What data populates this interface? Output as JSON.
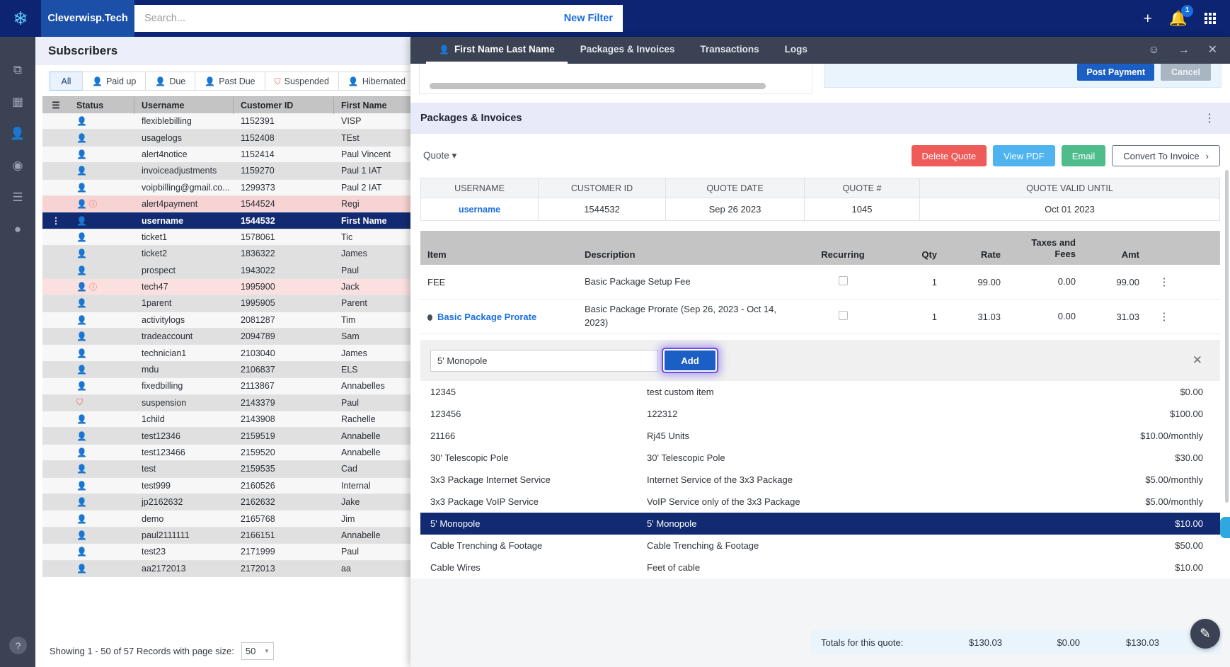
{
  "topbar": {
    "logo_icon": "footprint-logo-icon",
    "brand": "Cleverwisp.Tech",
    "search_placeholder": "Search...",
    "search_value": "",
    "new_filter": "New Filter",
    "plus_icon": "plus-icon",
    "bell_icon": "bell-icon",
    "notification_count": "1",
    "apps_icon": "apps-grid-icon"
  },
  "rail": {
    "items": [
      {
        "name": "copy-icon",
        "glyph": "⧉",
        "active": false
      },
      {
        "name": "dashboard-icon",
        "glyph": "▦",
        "active": false
      },
      {
        "name": "subscribers-icon",
        "glyph": "👤",
        "active": true
      },
      {
        "name": "globe-icon",
        "glyph": "◎",
        "active": false
      },
      {
        "name": "list-icon",
        "glyph": "☰",
        "active": false
      },
      {
        "name": "map-pin-icon",
        "glyph": "▾",
        "active": false
      }
    ],
    "help": "?"
  },
  "subscribers": {
    "title": "Subscribers",
    "tabs": [
      {
        "label": "All",
        "icon": "",
        "active": true
      },
      {
        "label": "Paid up",
        "icon": "person-green-icon",
        "active": false
      },
      {
        "label": "Due",
        "icon": "person-amber-icon",
        "active": false
      },
      {
        "label": "Past Due",
        "icon": "person-red-icon",
        "active": false
      },
      {
        "label": "Suspended",
        "icon": "person-outline-red-icon",
        "active": false
      },
      {
        "label": "Hibernated",
        "icon": "person-blue-icon",
        "active": false
      }
    ],
    "columns": [
      "",
      "Status",
      "Username",
      "Customer ID",
      "First Name"
    ],
    "rows": [
      {
        "status": "red",
        "warn": false,
        "username": "flexiblebilling",
        "customer_id": "1152391",
        "first_name": "VISP",
        "style": ""
      },
      {
        "status": "grey",
        "warn": false,
        "username": "usagelogs",
        "customer_id": "1152408",
        "first_name": "TEst",
        "style": "alt"
      },
      {
        "status": "red",
        "warn": false,
        "username": "alert4notice",
        "customer_id": "1152414",
        "first_name": "Paul Vincent",
        "style": ""
      },
      {
        "status": "green",
        "warn": false,
        "username": "invoiceadjustments",
        "customer_id": "1159270",
        "first_name": "Paul 1 IAT",
        "style": "alt"
      },
      {
        "status": "red",
        "warn": false,
        "username": "voipbilling@gmail.co...",
        "customer_id": "1299373",
        "first_name": "Paul 2 IAT",
        "style": ""
      },
      {
        "status": "red",
        "warn": true,
        "username": "alert4payment",
        "customer_id": "1544524",
        "first_name": "Regi",
        "style": "warn"
      },
      {
        "status": "amber",
        "warn": false,
        "username": "username",
        "customer_id": "1544532",
        "first_name": "First Name",
        "style": "sel"
      },
      {
        "status": "red",
        "warn": false,
        "username": "ticket1",
        "customer_id": "1578061",
        "first_name": "Tic",
        "style": ""
      },
      {
        "status": "red",
        "warn": false,
        "username": "ticket2",
        "customer_id": "1836322",
        "first_name": "James",
        "style": "alt"
      },
      {
        "status": "red",
        "warn": false,
        "username": "prospect",
        "customer_id": "1943022",
        "first_name": "Paul",
        "style": "alt"
      },
      {
        "status": "red",
        "warn": true,
        "username": "tech47",
        "customer_id": "1995900",
        "first_name": "Jack",
        "style": "warn-lt"
      },
      {
        "status": "red",
        "warn": false,
        "username": "1parent",
        "customer_id": "1995905",
        "first_name": "Parent",
        "style": "alt"
      },
      {
        "status": "red",
        "warn": false,
        "username": "activitylogs",
        "customer_id": "2081287",
        "first_name": "Tim",
        "style": ""
      },
      {
        "status": "red",
        "warn": false,
        "username": "tradeaccount",
        "customer_id": "2094789",
        "first_name": "Sam",
        "style": "alt"
      },
      {
        "status": "green",
        "warn": false,
        "username": "technician1",
        "customer_id": "2103040",
        "first_name": "James",
        "style": ""
      },
      {
        "status": "green",
        "warn": false,
        "username": "mdu",
        "customer_id": "2106837",
        "first_name": "ELS",
        "style": "alt"
      },
      {
        "status": "green",
        "warn": false,
        "username": "fixedbilling",
        "customer_id": "2113867",
        "first_name": "Annabelles",
        "style": ""
      },
      {
        "status": "red-outline",
        "warn": false,
        "username": "suspension",
        "customer_id": "2143379",
        "first_name": "Paul",
        "style": "alt"
      },
      {
        "status": "red",
        "warn": false,
        "username": "1child",
        "customer_id": "2143908",
        "first_name": "Rachelle",
        "style": ""
      },
      {
        "status": "grey",
        "warn": false,
        "username": "test12346",
        "customer_id": "2159519",
        "first_name": "Annabelle",
        "style": "alt"
      },
      {
        "status": "red",
        "warn": false,
        "username": "test123466",
        "customer_id": "2159520",
        "first_name": "Annabelle",
        "style": ""
      },
      {
        "status": "grey",
        "warn": false,
        "username": "test",
        "customer_id": "2159535",
        "first_name": "Cad",
        "style": "alt"
      },
      {
        "status": "red",
        "warn": false,
        "username": "test999",
        "customer_id": "2160526",
        "first_name": "Internal",
        "style": ""
      },
      {
        "status": "grey",
        "warn": false,
        "username": "jp2162632",
        "customer_id": "2162632",
        "first_name": "Jake",
        "style": "alt"
      },
      {
        "status": "red",
        "warn": false,
        "username": "demo",
        "customer_id": "2165768",
        "first_name": "Jim",
        "style": ""
      },
      {
        "status": "red",
        "warn": false,
        "username": "paul2111111",
        "customer_id": "2166151",
        "first_name": "Annabelle",
        "style": "alt"
      },
      {
        "status": "grey",
        "warn": false,
        "username": "test23",
        "customer_id": "2171999",
        "first_name": "Paul",
        "style": ""
      },
      {
        "status": "red",
        "warn": false,
        "username": "aa2172013",
        "customer_id": "2172013",
        "first_name": "aa",
        "style": "alt"
      }
    ],
    "footer_text": "Showing 1 - 50 of 57 Records with page size:",
    "page_size": "50"
  },
  "drawer": {
    "tabs": [
      {
        "label": "First Name Last Name",
        "icon": "person-amber-icon",
        "active": true
      },
      {
        "label": "Packages & Invoices",
        "icon": "",
        "active": false
      },
      {
        "label": "Transactions",
        "icon": "",
        "active": false
      },
      {
        "label": "Logs",
        "icon": "",
        "active": false
      }
    ],
    "right_icons": [
      "smiley-icon",
      "arrow-right-icon",
      "close-icon"
    ],
    "post_payment": "Post Payment",
    "cancel": "Cancel",
    "section_title": "Packages & Invoices",
    "kebab_icon": "kebab-menu-icon",
    "quote_selector": "Quote",
    "buttons": {
      "delete": "Delete Quote",
      "view_pdf": "View PDF",
      "email": "Email",
      "convert": "Convert To Invoice"
    },
    "quote_table": {
      "headers": [
        "USERNAME",
        "CUSTOMER ID",
        "QUOTE DATE",
        "QUOTE #",
        "QUOTE VALID UNTIL"
      ],
      "row": {
        "username": "username",
        "customer_id": "1544532",
        "quote_date": "Sep 26 2023",
        "quote_number": "1045",
        "valid_until": "Oct 01 2023"
      }
    },
    "items_headers": {
      "item": "Item",
      "description": "Description",
      "recurring": "Recurring",
      "qty": "Qty",
      "rate": "Rate",
      "taxes": "Taxes and Fees",
      "amt": "Amt"
    },
    "items": [
      {
        "item": "FEE",
        "is_link": false,
        "description": "Basic Package Setup Fee",
        "recurring": false,
        "qty": "1",
        "rate": "99.00",
        "taxes": "0.00",
        "amt": "99.00"
      },
      {
        "item": "Basic Package Prorate",
        "is_link": true,
        "description": "Basic Package Prorate (Sep 26, 2023 - Oct 14, 2023)",
        "recurring": false,
        "qty": "1",
        "rate": "31.03",
        "taxes": "0.00",
        "amt": "31.03"
      }
    ],
    "add_row": {
      "input_value": "5' Monopole",
      "input_placeholder": "",
      "add_label": "Add",
      "close_icon": "close-icon"
    },
    "options": [
      {
        "code": "12345",
        "desc": "test custom item",
        "price": "$0.00",
        "selected": false
      },
      {
        "code": "123456",
        "desc": "122312",
        "price": "$100.00",
        "selected": false
      },
      {
        "code": "21166",
        "desc": "Rj45 Units",
        "price": "$10.00/monthly",
        "selected": false
      },
      {
        "code": "30' Telescopic Pole",
        "desc": "30' Telescopic Pole",
        "price": "$30.00",
        "selected": false
      },
      {
        "code": "3x3 Package Internet Service",
        "desc": "Internet Service of the 3x3 Package",
        "price": "$5.00/monthly",
        "selected": false
      },
      {
        "code": "3x3 Package VoIP Service",
        "desc": "VoIP Service only of the 3x3 Package",
        "price": "$5.00/monthly",
        "selected": false
      },
      {
        "code": "5' Monopole",
        "desc": "5' Monopole",
        "price": "$10.00",
        "selected": true
      },
      {
        "code": "Cable Trenching & Footage",
        "desc": "Cable Trenching & Footage",
        "price": "$50.00",
        "selected": false
      },
      {
        "code": "Cable Wires",
        "desc": "Feet of cable",
        "price": "$10.00",
        "selected": false
      }
    ],
    "totals": {
      "label": "Totals for this quote:",
      "subtotal": "$130.03",
      "taxes": "$0.00",
      "total": "$130.03"
    },
    "chat_icon": "chat-fab-icon"
  }
}
